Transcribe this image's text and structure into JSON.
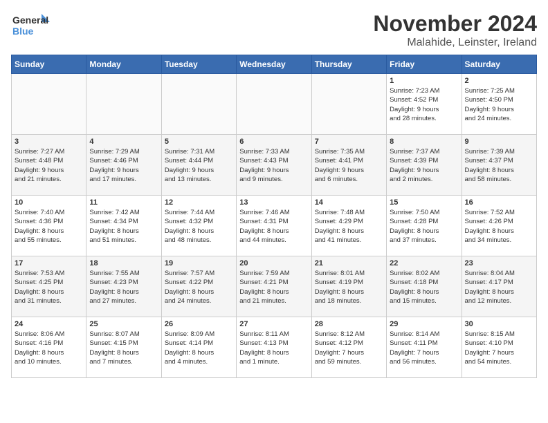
{
  "logo": {
    "line1": "General",
    "line2": "Blue"
  },
  "title": "November 2024",
  "subtitle": "Malahide, Leinster, Ireland",
  "weekdays": [
    "Sunday",
    "Monday",
    "Tuesday",
    "Wednesday",
    "Thursday",
    "Friday",
    "Saturday"
  ],
  "weeks": [
    [
      {
        "day": "",
        "info": ""
      },
      {
        "day": "",
        "info": ""
      },
      {
        "day": "",
        "info": ""
      },
      {
        "day": "",
        "info": ""
      },
      {
        "day": "",
        "info": ""
      },
      {
        "day": "1",
        "info": "Sunrise: 7:23 AM\nSunset: 4:52 PM\nDaylight: 9 hours\nand 28 minutes."
      },
      {
        "day": "2",
        "info": "Sunrise: 7:25 AM\nSunset: 4:50 PM\nDaylight: 9 hours\nand 24 minutes."
      }
    ],
    [
      {
        "day": "3",
        "info": "Sunrise: 7:27 AM\nSunset: 4:48 PM\nDaylight: 9 hours\nand 21 minutes."
      },
      {
        "day": "4",
        "info": "Sunrise: 7:29 AM\nSunset: 4:46 PM\nDaylight: 9 hours\nand 17 minutes."
      },
      {
        "day": "5",
        "info": "Sunrise: 7:31 AM\nSunset: 4:44 PM\nDaylight: 9 hours\nand 13 minutes."
      },
      {
        "day": "6",
        "info": "Sunrise: 7:33 AM\nSunset: 4:43 PM\nDaylight: 9 hours\nand 9 minutes."
      },
      {
        "day": "7",
        "info": "Sunrise: 7:35 AM\nSunset: 4:41 PM\nDaylight: 9 hours\nand 6 minutes."
      },
      {
        "day": "8",
        "info": "Sunrise: 7:37 AM\nSunset: 4:39 PM\nDaylight: 9 hours\nand 2 minutes."
      },
      {
        "day": "9",
        "info": "Sunrise: 7:39 AM\nSunset: 4:37 PM\nDaylight: 8 hours\nand 58 minutes."
      }
    ],
    [
      {
        "day": "10",
        "info": "Sunrise: 7:40 AM\nSunset: 4:36 PM\nDaylight: 8 hours\nand 55 minutes."
      },
      {
        "day": "11",
        "info": "Sunrise: 7:42 AM\nSunset: 4:34 PM\nDaylight: 8 hours\nand 51 minutes."
      },
      {
        "day": "12",
        "info": "Sunrise: 7:44 AM\nSunset: 4:32 PM\nDaylight: 8 hours\nand 48 minutes."
      },
      {
        "day": "13",
        "info": "Sunrise: 7:46 AM\nSunset: 4:31 PM\nDaylight: 8 hours\nand 44 minutes."
      },
      {
        "day": "14",
        "info": "Sunrise: 7:48 AM\nSunset: 4:29 PM\nDaylight: 8 hours\nand 41 minutes."
      },
      {
        "day": "15",
        "info": "Sunrise: 7:50 AM\nSunset: 4:28 PM\nDaylight: 8 hours\nand 37 minutes."
      },
      {
        "day": "16",
        "info": "Sunrise: 7:52 AM\nSunset: 4:26 PM\nDaylight: 8 hours\nand 34 minutes."
      }
    ],
    [
      {
        "day": "17",
        "info": "Sunrise: 7:53 AM\nSunset: 4:25 PM\nDaylight: 8 hours\nand 31 minutes."
      },
      {
        "day": "18",
        "info": "Sunrise: 7:55 AM\nSunset: 4:23 PM\nDaylight: 8 hours\nand 27 minutes."
      },
      {
        "day": "19",
        "info": "Sunrise: 7:57 AM\nSunset: 4:22 PM\nDaylight: 8 hours\nand 24 minutes."
      },
      {
        "day": "20",
        "info": "Sunrise: 7:59 AM\nSunset: 4:21 PM\nDaylight: 8 hours\nand 21 minutes."
      },
      {
        "day": "21",
        "info": "Sunrise: 8:01 AM\nSunset: 4:19 PM\nDaylight: 8 hours\nand 18 minutes."
      },
      {
        "day": "22",
        "info": "Sunrise: 8:02 AM\nSunset: 4:18 PM\nDaylight: 8 hours\nand 15 minutes."
      },
      {
        "day": "23",
        "info": "Sunrise: 8:04 AM\nSunset: 4:17 PM\nDaylight: 8 hours\nand 12 minutes."
      }
    ],
    [
      {
        "day": "24",
        "info": "Sunrise: 8:06 AM\nSunset: 4:16 PM\nDaylight: 8 hours\nand 10 minutes."
      },
      {
        "day": "25",
        "info": "Sunrise: 8:07 AM\nSunset: 4:15 PM\nDaylight: 8 hours\nand 7 minutes."
      },
      {
        "day": "26",
        "info": "Sunrise: 8:09 AM\nSunset: 4:14 PM\nDaylight: 8 hours\nand 4 minutes."
      },
      {
        "day": "27",
        "info": "Sunrise: 8:11 AM\nSunset: 4:13 PM\nDaylight: 8 hours\nand 1 minute."
      },
      {
        "day": "28",
        "info": "Sunrise: 8:12 AM\nSunset: 4:12 PM\nDaylight: 7 hours\nand 59 minutes."
      },
      {
        "day": "29",
        "info": "Sunrise: 8:14 AM\nSunset: 4:11 PM\nDaylight: 7 hours\nand 56 minutes."
      },
      {
        "day": "30",
        "info": "Sunrise: 8:15 AM\nSunset: 4:10 PM\nDaylight: 7 hours\nand 54 minutes."
      }
    ]
  ]
}
